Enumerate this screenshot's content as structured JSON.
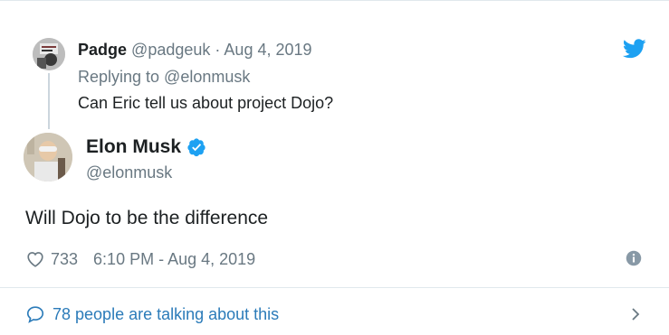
{
  "colors": {
    "twitter_blue": "#1da1f2",
    "link_blue": "#2b7bb9",
    "muted_gray": "#697882",
    "text_dark": "#1c2022",
    "border": "#e1e8ed"
  },
  "reply_tweet": {
    "author_name": "Padge",
    "author_handle": "@padgeuk",
    "separator": "·",
    "date": "Aug 4, 2019",
    "replying_to": "Replying to @elonmusk",
    "text": "Can Eric tell us about project Dojo?",
    "avatar_icon": "user-avatar-photo"
  },
  "main_tweet": {
    "author_name": "Elon Musk",
    "author_handle": "@elonmusk",
    "verified_icon": "verified-badge-icon",
    "text": "Will Dojo to be the difference",
    "likes": "733",
    "timestamp": "6:10 PM - Aug 4, 2019"
  },
  "footer": {
    "talking_text": "78 people are talking about this"
  },
  "icons": {
    "brand": "twitter-bird-icon",
    "like": "heart-icon",
    "info": "info-icon",
    "conversation": "speech-bubble-icon",
    "next": "chevron-right-icon"
  }
}
